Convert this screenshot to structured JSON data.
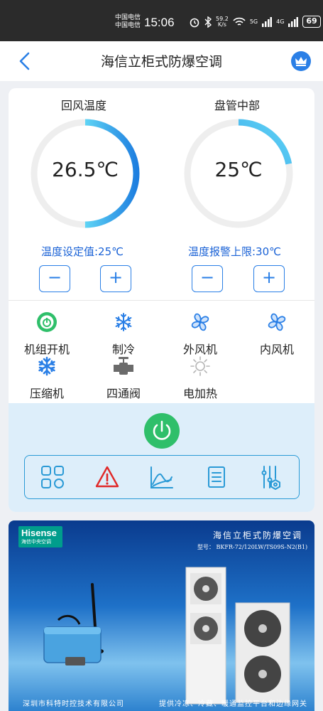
{
  "status_bar": {
    "carrier_1": "中国电信",
    "carrier_2": "中国电信",
    "time": "15:06",
    "net_speed_1": "59.2",
    "net_speed_2": "K/s",
    "net_5g": "5G",
    "net_4g": "4G",
    "battery": "69"
  },
  "header": {
    "title": "海信立柜式防爆空调"
  },
  "gauges": [
    {
      "label": "回风温度",
      "value": "26.5℃",
      "fill_fraction": 0.5,
      "setting": "温度设定值:25℃"
    },
    {
      "label": "盘管中部",
      "value": "25℃",
      "fill_fraction": 0.22,
      "setting": "温度报警上限:30℃"
    }
  ],
  "stepper": {
    "minus": "−",
    "plus": "+"
  },
  "status_items": [
    {
      "label": "机组开机",
      "icon": "power-on-icon"
    },
    {
      "label": "制冷",
      "icon": "snowflake-icon"
    },
    {
      "label": "外风机",
      "icon": "fan-icon"
    },
    {
      "label": "内风机",
      "icon": "fan-icon"
    },
    {
      "label": "压缩机",
      "icon": "snowflake-icon"
    },
    {
      "label": "四通阀",
      "icon": "valve-icon"
    },
    {
      "label": "电加热",
      "icon": "sun-icon"
    }
  ],
  "toolbar": [
    "grid-icon",
    "warning-icon",
    "chart-icon",
    "list-icon",
    "settings-icon"
  ],
  "colors": {
    "accent": "#2a7fe6",
    "power_green": "#2fbf6a",
    "warning_red": "#e02828",
    "gauge_track": "#eeeeee",
    "gauge_fill_start": "#1e7fe0",
    "gauge_fill_end": "#5fd4f5"
  },
  "banner": {
    "brand": "Hisense",
    "brand_sub": "海信中央空调",
    "title": "海信立柜式防爆空调",
    "model": "型号： BKFR-72/120LW/TS09S-N2(B1)",
    "footer_left": "深圳市科特时控技术有限公司",
    "footer_right": "提供冷冻、冷藏、暖通监控平台和边缘网关"
  }
}
